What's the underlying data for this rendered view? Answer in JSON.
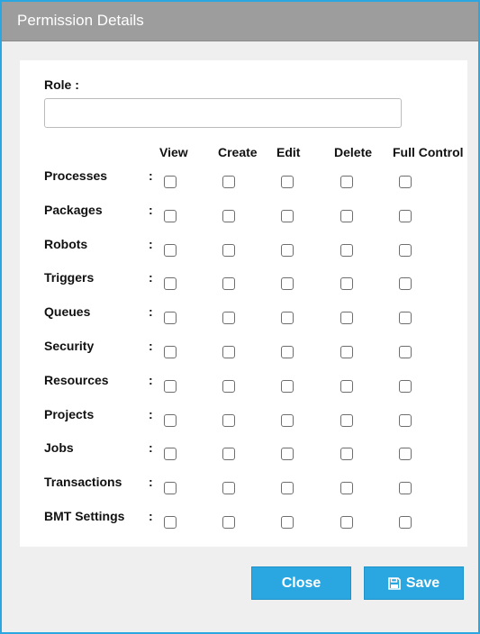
{
  "dialog": {
    "title": "Permission Details"
  },
  "role": {
    "label": "Role :",
    "value": "",
    "placeholder": ""
  },
  "columns": [
    "View",
    "Create",
    "Edit",
    "Delete",
    "Full Control"
  ],
  "rows": [
    {
      "label": "Processes",
      "checked": [
        false,
        false,
        false,
        false,
        false
      ]
    },
    {
      "label": "Packages",
      "checked": [
        false,
        false,
        false,
        false,
        false
      ]
    },
    {
      "label": "Robots",
      "checked": [
        false,
        false,
        false,
        false,
        false
      ]
    },
    {
      "label": "Triggers",
      "checked": [
        false,
        false,
        false,
        false,
        false
      ]
    },
    {
      "label": "Queues",
      "checked": [
        false,
        false,
        false,
        false,
        false
      ]
    },
    {
      "label": "Security",
      "checked": [
        false,
        false,
        false,
        false,
        false
      ]
    },
    {
      "label": "Resources",
      "checked": [
        false,
        false,
        false,
        false,
        false
      ]
    },
    {
      "label": "Projects",
      "checked": [
        false,
        false,
        false,
        false,
        false
      ]
    },
    {
      "label": "Jobs",
      "checked": [
        false,
        false,
        false,
        false,
        false
      ]
    },
    {
      "label": "Transactions",
      "checked": [
        false,
        false,
        false,
        false,
        false
      ]
    },
    {
      "label": "BMT Settings",
      "checked": [
        false,
        false,
        false,
        false,
        false
      ]
    }
  ],
  "separator": ":",
  "buttons": {
    "close": "Close",
    "save": "Save",
    "save_icon": "floppy-disk-icon"
  },
  "colors": {
    "accent": "#2aa7e0",
    "titlebar": "#9d9d9d"
  }
}
